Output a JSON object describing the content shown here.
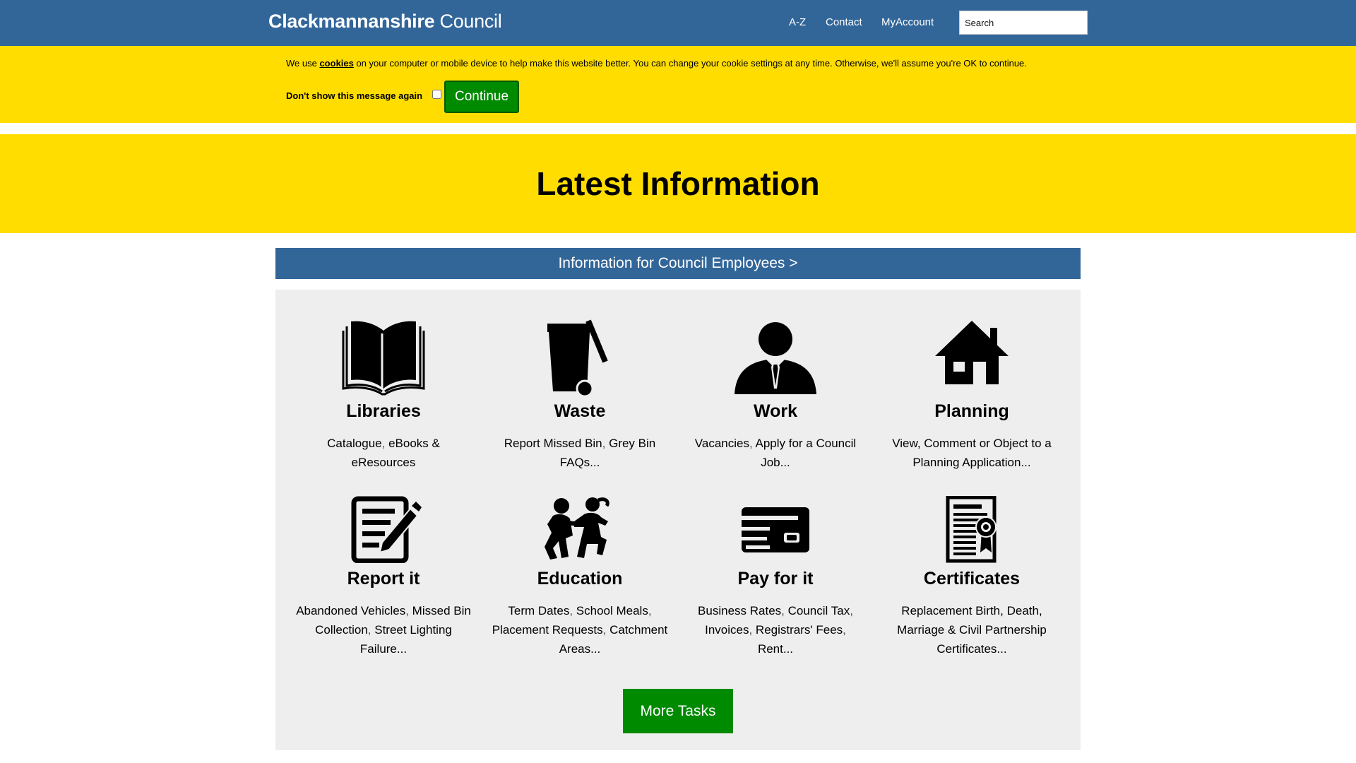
{
  "header": {
    "brand_bold": "Clackmannanshire",
    "brand_light": " Council",
    "nav": [
      "A-Z",
      "Contact",
      "MyAccount"
    ],
    "search_placeholder": "Search"
  },
  "cookie_banner": {
    "text_before": "We use ",
    "link": "cookies",
    "text_after": " on your computer or mobile device to help make this website better. You can change your cookie settings at any time. Otherwise, we'll assume you're OK to continue.",
    "checkbox_label": "Don't show this message again",
    "continue_label": "Continue"
  },
  "hero": {
    "title": "Latest Information"
  },
  "employees_link": "Information for Council Employees >",
  "tiles": [
    {
      "title": "Libraries",
      "icon": "book-icon",
      "links": [
        "Catalogue",
        "eBooks & eResources"
      ]
    },
    {
      "title": "Waste",
      "icon": "wheelie-bin-icon",
      "links": [
        "Report Missed Bin",
        "Grey Bin FAQs..."
      ]
    },
    {
      "title": "Work",
      "icon": "person-with-tie-icon",
      "links": [
        "Vacancies",
        "Apply for a Council Job..."
      ]
    },
    {
      "title": "Planning",
      "icon": "house-icon",
      "links": [
        "View, Comment or Object to a Planning Application..."
      ]
    },
    {
      "title": "Report it",
      "icon": "form-with-pencil-icon",
      "links": [
        "Abandoned Vehicles",
        "Missed Bin Collection",
        "Street Lighting Failure..."
      ]
    },
    {
      "title": "Education",
      "icon": "children-icon",
      "links": [
        "Term Dates",
        "School Meals",
        "Placement Requests",
        "Catchment Areas..."
      ]
    },
    {
      "title": "Pay for it",
      "icon": "credit-card-icon",
      "links": [
        "Business Rates",
        "Council Tax",
        "Invoices",
        "Registrars' Fees",
        "Rent..."
      ]
    },
    {
      "title": "Certificates",
      "icon": "certificate-icon",
      "links": [
        "Replacement Birth, Death, Marriage & Civil Partnership Certificates..."
      ]
    }
  ],
  "more_tasks_label": "More Tasks",
  "colors": {
    "header_blue": "#326699",
    "banner_yellow": "#ffdd00",
    "button_green": "#008a00",
    "panel_grey": "#eeeeee"
  }
}
